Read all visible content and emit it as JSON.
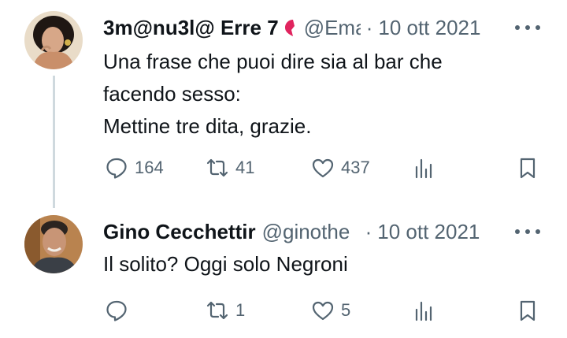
{
  "tweets": [
    {
      "display_name": "3m@nu3l@ Erre 7",
      "handle": "@Ema",
      "separator": "·",
      "date": "10 ott 2021",
      "text_lines": [
        "Una frase che puoi dire sia al bar che",
        "facendo sesso:",
        "Mettine tre dita, grazie."
      ],
      "replies": "164",
      "retweets": "41",
      "likes": "437"
    },
    {
      "display_name": "Gino Cecchettir",
      "handle": "@ginothe",
      "separator": "·",
      "date": "10 ott 2021",
      "text_lines": [
        "Il solito? Oggi solo Negroni"
      ],
      "replies": "",
      "retweets": "1",
      "likes": "5"
    }
  ],
  "icons": {
    "reply": "speech-bubble-icon",
    "retweet": "retweet-arrows-icon",
    "like": "heart-outline-icon",
    "views": "bar-chart-icon",
    "bookmark": "bookmark-icon",
    "more": "ellipsis-icon",
    "badge": "red-heart-icon"
  },
  "colors": {
    "text": "#0f1419",
    "secondary": "#536471",
    "thread_line": "#cfd9de",
    "badge_red": "#e0245e"
  }
}
